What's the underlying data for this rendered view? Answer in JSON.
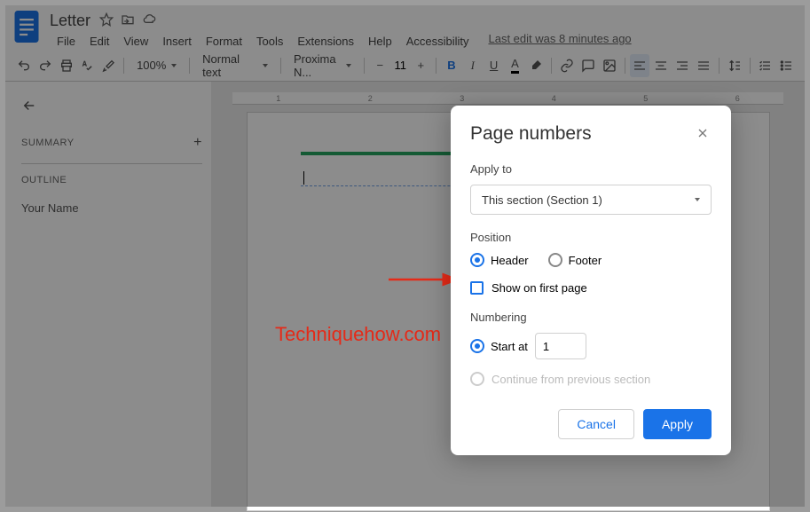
{
  "header": {
    "title": "Letter",
    "menus": [
      "File",
      "Edit",
      "View",
      "Insert",
      "Format",
      "Tools",
      "Extensions",
      "Help",
      "Accessibility"
    ],
    "last_edit": "Last edit was 8 minutes ago"
  },
  "toolbar": {
    "zoom": "100%",
    "style": "Normal text",
    "font": "Proxima N...",
    "font_size": "11"
  },
  "sidebar": {
    "summary_heading": "SUMMARY",
    "outline_heading": "OUTLINE",
    "items": [
      "Your Name"
    ]
  },
  "ruler": [
    "1",
    "2",
    "3",
    "4",
    "5",
    "6"
  ],
  "watermark": "Techniquehow.com",
  "dialog": {
    "title": "Page numbers",
    "apply_to_label": "Apply to",
    "apply_to_value": "This section (Section 1)",
    "position_label": "Position",
    "position_header_label": "Header",
    "position_footer_label": "Footer",
    "show_first_label": "Show on first page",
    "numbering_label": "Numbering",
    "start_at_label": "Start at",
    "start_at_value": "1",
    "continue_label": "Continue from previous section",
    "cancel": "Cancel",
    "apply": "Apply"
  }
}
